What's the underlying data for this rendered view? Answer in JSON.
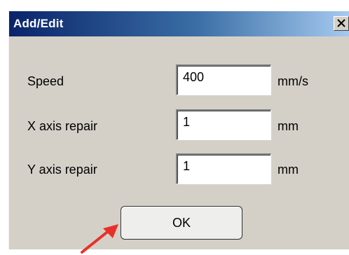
{
  "dialog": {
    "title": "Add/Edit",
    "close_glyph": "X"
  },
  "fields": [
    {
      "label": "Speed",
      "value": "400",
      "unit": "mm/s"
    },
    {
      "label": "X axis repair",
      "value": "1",
      "unit": "mm"
    },
    {
      "label": "Y axis repair",
      "value": "1",
      "unit": "mm"
    }
  ],
  "ok_label": "OK",
  "annotation": {
    "icon": "red-arrow-icon",
    "color": "#e8302a"
  },
  "colors": {
    "titlebar_start": "#0a246a",
    "titlebar_end": "#a6caf0",
    "dialog_bg": "#d4d0c8"
  }
}
